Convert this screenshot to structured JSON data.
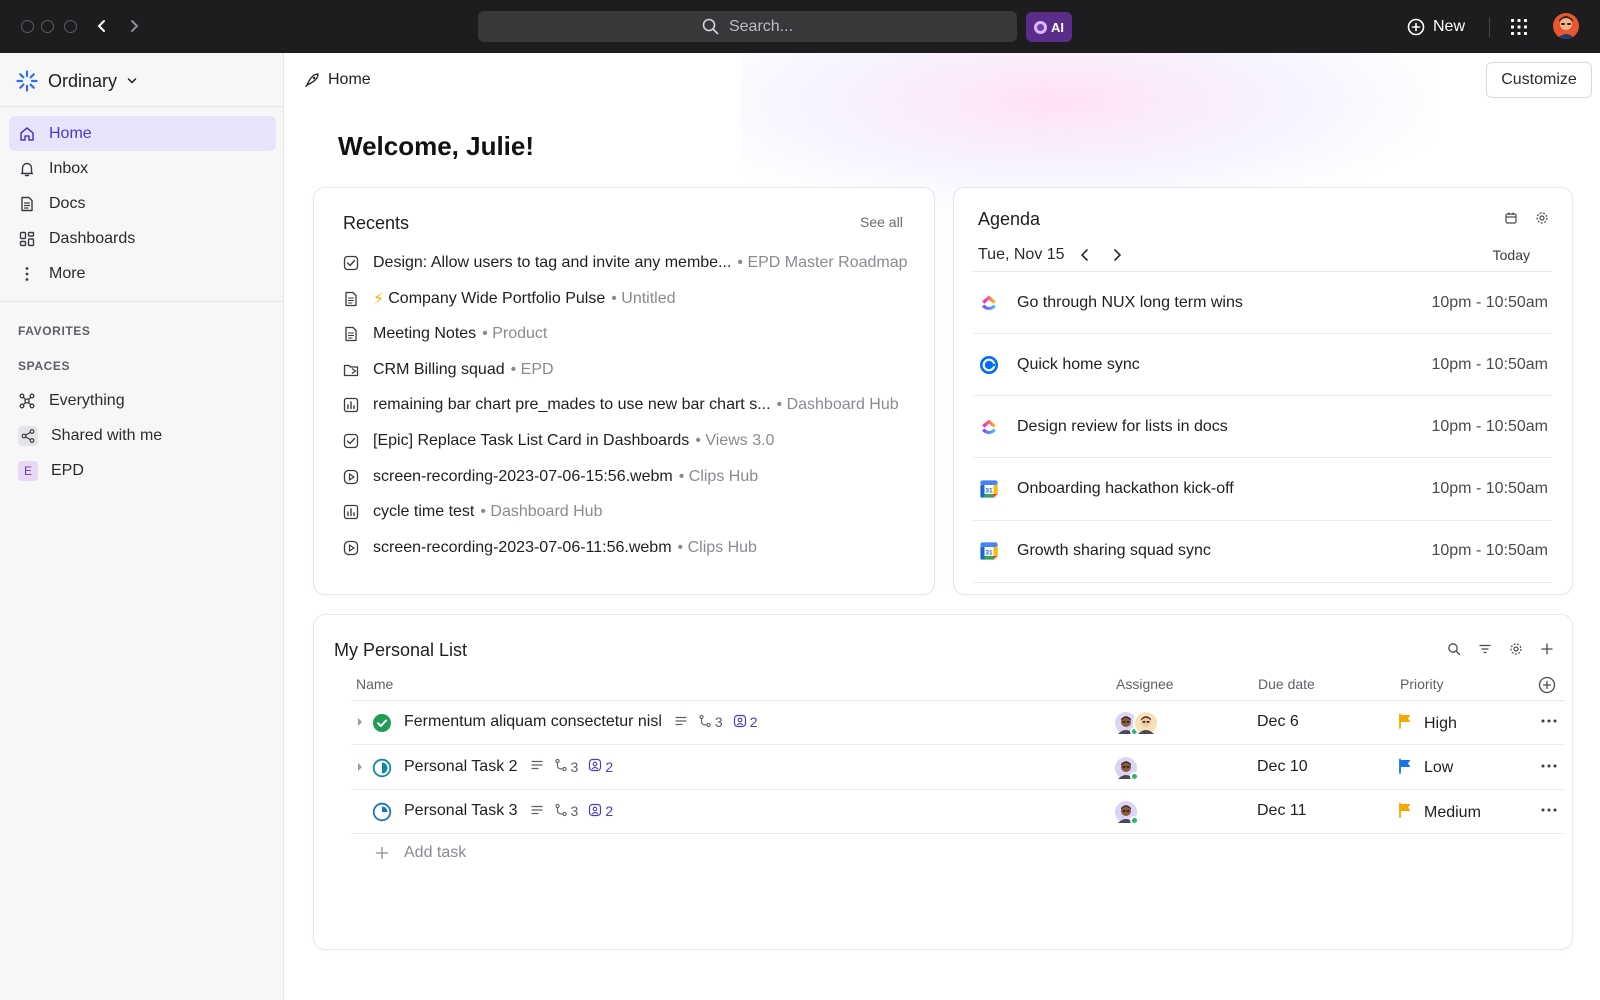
{
  "topbar": {
    "search_placeholder": "Search...",
    "ai_label": "AI",
    "new_label": "New"
  },
  "sidebar": {
    "workspace_name": "Ordinary",
    "nav": [
      {
        "label": "Home",
        "icon": "home-icon",
        "active": true
      },
      {
        "label": "Inbox",
        "icon": "bell-icon",
        "active": false
      },
      {
        "label": "Docs",
        "icon": "doc-icon",
        "active": false
      },
      {
        "label": "Dashboards",
        "icon": "dashboard-icon",
        "active": false
      },
      {
        "label": "More",
        "icon": "more-vertical-icon",
        "active": false
      }
    ],
    "favorites_label": "FAVORITES",
    "spaces_label": "SPACES",
    "spaces": [
      {
        "label": "Everything",
        "icon": "everything-icon"
      },
      {
        "label": "Shared with me",
        "icon": "share-icon"
      },
      {
        "label": "EPD",
        "badge": "E"
      }
    ]
  },
  "header": {
    "breadcrumb": "Home",
    "customize_label": "Customize",
    "welcome": "Welcome, Julie!"
  },
  "recents": {
    "title": "Recents",
    "see_all": "See all",
    "items": [
      {
        "icon": "task-check-icon",
        "name": "Design: Allow users to tag and invite any membe...",
        "location": "• EPD Master Roadmap"
      },
      {
        "icon": "doc-icon",
        "prefix": "⚡",
        "name": "Company Wide Portfolio Pulse",
        "location": "• Untitled"
      },
      {
        "icon": "doc-icon",
        "name": "Meeting Notes",
        "location": "• Product"
      },
      {
        "icon": "folder-share-icon",
        "name": "CRM Billing squad",
        "location": "• EPD"
      },
      {
        "icon": "dashboard-chart-icon",
        "name": "remaining bar chart pre_mades to use new bar chart s...",
        "location": "• Dashboard Hub"
      },
      {
        "icon": "task-check-icon",
        "name": "[Epic] Replace Task List Card in Dashboards",
        "location": "• Views 3.0"
      },
      {
        "icon": "play-circle-icon",
        "name": "screen-recording-2023-07-06-15:56.webm",
        "location": "• Clips Hub"
      },
      {
        "icon": "dashboard-chart-icon",
        "name": "cycle time test",
        "location": "• Dashboard Hub"
      },
      {
        "icon": "play-circle-icon",
        "name": "screen-recording-2023-07-06-11:56.webm",
        "location": "• Clips Hub"
      }
    ]
  },
  "agenda": {
    "title": "Agenda",
    "date": "Tue, Nov 15",
    "today_label": "Today",
    "events": [
      {
        "icon": "clickup-logo-icon",
        "name": "Go through NUX long term wins",
        "time": "10pm - 10:50am"
      },
      {
        "icon": "calendly-logo-icon",
        "name": "Quick home sync",
        "time": "10pm - 10:50am"
      },
      {
        "icon": "clickup-logo-icon",
        "name": "Design review for lists in docs",
        "time": "10pm - 10:50am"
      },
      {
        "icon": "google-calendar-icon",
        "name": "Onboarding hackathon kick-off",
        "time": "10pm - 10:50am"
      },
      {
        "icon": "google-calendar-icon",
        "name": "Growth sharing squad sync",
        "time": "10pm - 10:50am"
      }
    ]
  },
  "personal_list": {
    "title": "My Personal List",
    "columns": {
      "name": "Name",
      "assignee": "Assignee",
      "due": "Due date",
      "priority": "Priority"
    },
    "tasks": [
      {
        "name": "Fermentum aliquam consectetur nisl",
        "status": "complete",
        "subtasks": "3",
        "mentions": "2",
        "assignees": 2,
        "due": "Dec 6",
        "priority": "High",
        "priority_color": "#f5a800"
      },
      {
        "name": "Personal Task 2",
        "status": "in-progress",
        "subtasks": "3",
        "mentions": "2",
        "assignees": 1,
        "due": "Dec 10",
        "priority": "Low",
        "priority_color": "#1a73e8"
      },
      {
        "name": "Personal Task 3",
        "status": "todo",
        "subtasks": "3",
        "mentions": "2",
        "assignees": 1,
        "due": "Dec 11",
        "priority": "Medium",
        "priority_color": "#f5a800"
      }
    ],
    "add_task_label": "Add task"
  },
  "colors": {
    "accent": "#4b3bbd",
    "active_nav_bg": "#e8e3fa",
    "topbar_bg": "#1d1d1f",
    "complete_green": "#1f9d55",
    "status_teal": "#0f8aa0"
  }
}
